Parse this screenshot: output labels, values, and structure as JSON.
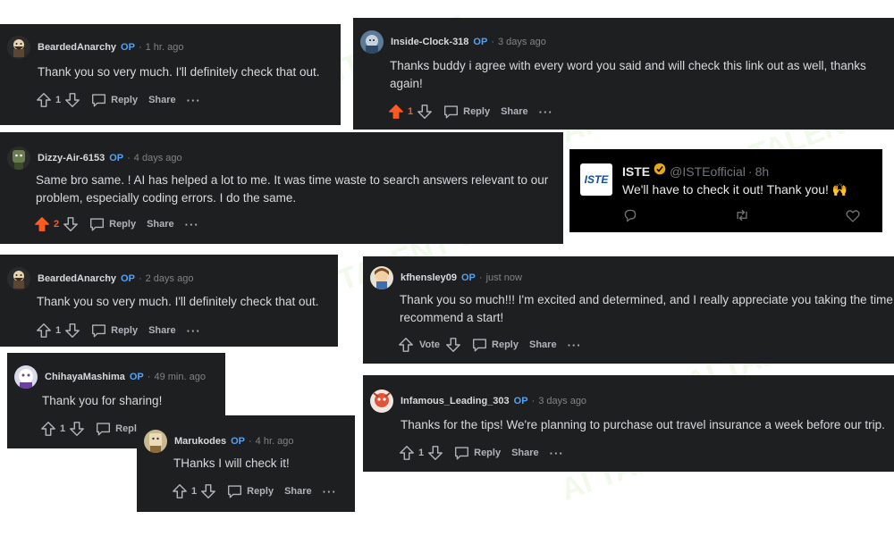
{
  "icons": {
    "upvote": "arrow-up-icon",
    "downvote": "arrow-down-icon",
    "reply": "speech-bubble-icon",
    "more": "ellipsis-icon",
    "verified": "verified-badge-icon",
    "tweet_reply": "speech-bubble-icon",
    "retweet": "retweet-icon",
    "like": "heart-icon"
  },
  "colors": {
    "card_bg": "#1e1f21",
    "op_blue": "#4fa3f7",
    "upvote_orange": "#ff5a1f",
    "tweet_bg": "#000000",
    "verified_gold": "#e6a817"
  },
  "watermark": "AI TALENT SPACE",
  "comments": [
    {
      "user": "BeardedAnarchy",
      "op": "OP",
      "time": "1 hr. ago",
      "text": "Thank you so very much. I'll definitely check that out.",
      "votes": "1",
      "upvoted": false,
      "reply": "Reply",
      "share": "Share",
      "more": "···"
    },
    {
      "user": "Inside-Clock-318",
      "op": "OP",
      "time": "3 days ago",
      "text": "Thanks buddy i agree with every word you said and will check this link out as well, thanks again!",
      "votes": "1",
      "upvoted": true,
      "reply": "Reply",
      "share": "Share",
      "more": "···"
    },
    {
      "user": "Dizzy-Air-6153",
      "op": "OP",
      "time": "4 days ago",
      "text": "Same bro same. ! AI has helped a lot to me. It was time waste to search answers relevant to our problem, especially coding errors. I do the same.",
      "votes": "2",
      "upvoted": true,
      "reply": "Reply",
      "share": "Share",
      "more": "···"
    },
    {
      "user": "BeardedAnarchy",
      "op": "OP",
      "time": "2 days ago",
      "text": "Thank you so very much. I'll definitely check that out.",
      "votes": "1",
      "upvoted": false,
      "reply": "Reply",
      "share": "Share",
      "more": "···"
    },
    {
      "user": "kfhensley09",
      "op": "OP",
      "time": "just now",
      "text": "Thank you so much!!! I'm excited and determined, and I really appreciate you taking the time to recommend a start!",
      "votes": "Vote",
      "upvoted": false,
      "reply": "Reply",
      "share": "Share",
      "more": "···"
    },
    {
      "user": "ChihayaMashima",
      "op": "OP",
      "time": "49 min. ago",
      "text": "Thank you for sharing!",
      "votes": "1",
      "upvoted": false,
      "reply": "Reply",
      "share": "Share",
      "more": "···"
    },
    {
      "user": "Marukodes",
      "op": "OP",
      "time": "4 hr. ago",
      "text": "THanks I will check it!",
      "votes": "1",
      "upvoted": false,
      "reply": "Reply",
      "share": "Share",
      "more": "···"
    },
    {
      "user": "Infamous_Leading_303",
      "op": "OP",
      "time": "3 days ago",
      "text": "Thanks for the tips! We're planning to purchase out travel insurance a week before our trip.",
      "votes": "1",
      "upvoted": false,
      "reply": "Reply",
      "share": "Share",
      "more": "···"
    }
  ],
  "tweet": {
    "logo_text": "ISTE",
    "name": "ISTE",
    "handle": "@ISTEofficial",
    "sep": "·",
    "time": "8h",
    "text": "We'll have to check it out! Thank you! 🙌"
  }
}
